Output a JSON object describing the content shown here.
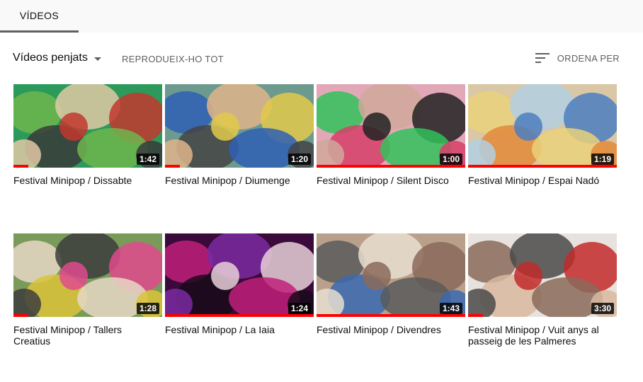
{
  "tabs": {
    "videos": "VÍDEOS"
  },
  "toolbar": {
    "uploads_label": "Vídeos penjats",
    "play_all_label": "REPRODUEIX-HO TOT",
    "sort_label": "ORDENA PER"
  },
  "colors": {
    "progress": "#ff0000",
    "tab_underline": "#606060"
  },
  "videos": [
    {
      "title": "Festival Minipop / Dissabte",
      "duration": "1:42",
      "watched_fraction": 0.1,
      "palette": [
        "#2c9a5a",
        "#6fb64e",
        "#e0c9a4",
        "#c3372f",
        "#3a3a3a"
      ]
    },
    {
      "title": "Festival Minipop / Diumenge",
      "duration": "1:20",
      "watched_fraction": 0.1,
      "palette": [
        "#6d9a8e",
        "#2f5fb4",
        "#dfb58a",
        "#e2c94a",
        "#444444"
      ]
    },
    {
      "title": "Festival Minipop / Silent Disco",
      "duration": "1:00",
      "watched_fraction": 1.0,
      "palette": [
        "#e2a8b8",
        "#31c25a",
        "#cfa89a",
        "#222222",
        "#d63f6a"
      ]
    },
    {
      "title": "Festival Minipop / Espai Nadó",
      "duration": "1:19",
      "watched_fraction": 1.0,
      "palette": [
        "#d9c7a5",
        "#e9d17a",
        "#b1cfe0",
        "#4c7ec0",
        "#e38a3a"
      ]
    },
    {
      "title": "Festival Minipop / Tallers Creatius",
      "duration": "1:28",
      "watched_fraction": 0.1,
      "palette": [
        "#7a9a5a",
        "#e6d8c6",
        "#3d3d3d",
        "#e04a8e",
        "#dac33a"
      ]
    },
    {
      "title": "Festival Minipop / La Iaia",
      "duration": "1:24",
      "watched_fraction": 1.0,
      "palette": [
        "#3a0a3a",
        "#c0207a",
        "#7a2aa0",
        "#e8d0d8",
        "#1a0a1a"
      ]
    },
    {
      "title": "Festival Minipop / Divendres",
      "duration": "1:43",
      "watched_fraction": 1.0,
      "palette": [
        "#b9a08a",
        "#5a5a5a",
        "#e7ded0",
        "#8a6a5a",
        "#3a6ab0"
      ]
    },
    {
      "title": "Festival Minipop / Vuit anys al passeig de les Palmeres",
      "duration": "3:30",
      "watched_fraction": 0.1,
      "palette": [
        "#e7e2de",
        "#8a6a5a",
        "#4a4a4a",
        "#c22a2a",
        "#d8b8a0"
      ]
    }
  ]
}
